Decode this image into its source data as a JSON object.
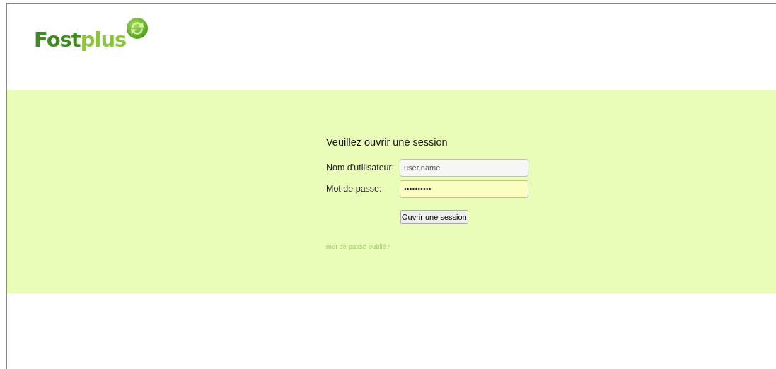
{
  "logo": {
    "text_dark": "Fost",
    "text_light": "plus"
  },
  "login": {
    "title": "Veuillez ouvrir une session",
    "fields": [
      {
        "label": "Nom d'utilisateur:",
        "value": "user.name",
        "highlighted": false
      },
      {
        "label": "Mot de passe:",
        "value": "••••••••••",
        "highlighted": true
      }
    ],
    "submit": "Ouvrir une session",
    "forgot_link": "mot de passe oublié?"
  }
}
